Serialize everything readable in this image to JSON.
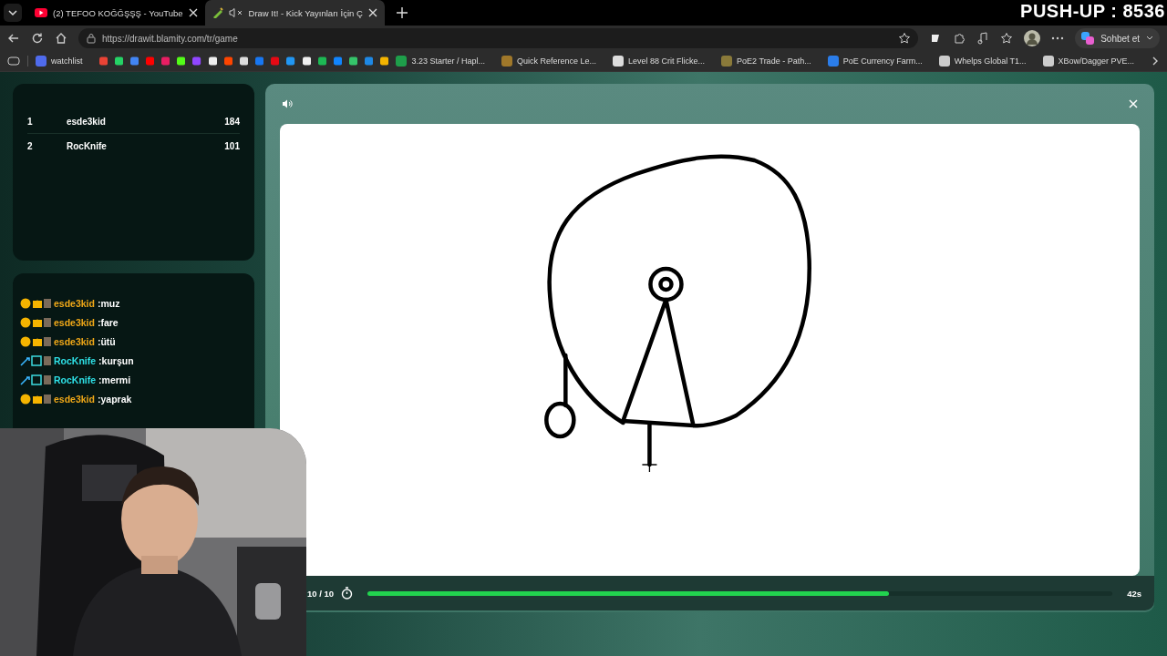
{
  "browser": {
    "tabs": [
      {
        "title": "(2) TEFOO KOĞĞŞŞŞ - YouTube",
        "selected": false,
        "kind": "video"
      },
      {
        "title": "Draw It! - Kick Yayınları İçin Ç",
        "selected": true,
        "kind": "game"
      }
    ],
    "url": "https://drawit.blamity.com/tr/game",
    "chat_button": "Sohbet et",
    "bookmarks": [
      {
        "kind": "labeled",
        "label": "watchlist",
        "color": "#4f6bed"
      },
      {
        "kind": "icon",
        "color": "#ea4335"
      },
      {
        "kind": "icon",
        "color": "#25d366"
      },
      {
        "kind": "icon",
        "color": "#4285f4"
      },
      {
        "kind": "icon",
        "color": "#ff0000"
      },
      {
        "kind": "icon",
        "color": "#e91e63"
      },
      {
        "kind": "icon",
        "color": "#53fc18"
      },
      {
        "kind": "icon",
        "color": "#9146ff"
      },
      {
        "kind": "icon",
        "color": "#eeeeee"
      },
      {
        "kind": "icon",
        "color": "#ff4500"
      },
      {
        "kind": "icon",
        "color": "#dddddd"
      },
      {
        "kind": "icon",
        "color": "#1877f2"
      },
      {
        "kind": "icon",
        "color": "#e50914"
      },
      {
        "kind": "icon",
        "color": "#2196f3"
      },
      {
        "kind": "icon",
        "color": "#f0f0f0"
      },
      {
        "kind": "icon",
        "color": "#1db954"
      },
      {
        "kind": "icon",
        "color": "#1185fe"
      },
      {
        "kind": "icon",
        "color": "#35c46a"
      },
      {
        "kind": "icon",
        "color": "#1e88e5"
      },
      {
        "kind": "icon",
        "color": "#f4b400"
      },
      {
        "kind": "labeled",
        "label": "3.23 Starter / Hapl...",
        "color": "#1e9e4a"
      },
      {
        "kind": "labeled",
        "label": "Quick Reference Le...",
        "color": "#a0782a"
      },
      {
        "kind": "labeled",
        "label": "Level 88 Crit Flicke...",
        "color": "#dddddd"
      },
      {
        "kind": "labeled",
        "label": "PoE2 Trade - Path...",
        "color": "#8a7a3a"
      },
      {
        "kind": "labeled",
        "label": "PoE Currency Farm...",
        "color": "#2b7de9"
      },
      {
        "kind": "labeled",
        "label": "Whelps Global T1...",
        "color": "#cccccc"
      },
      {
        "kind": "labeled",
        "label": "XBow/Dagger PVE...",
        "color": "#cccccc"
      }
    ]
  },
  "overlay": {
    "text": "PUSH-UP : 8536"
  },
  "leaderboard": [
    {
      "rank": "1",
      "name": "esde3kid",
      "score": "184"
    },
    {
      "rank": "2",
      "name": "RocKnife",
      "score": "101"
    }
  ],
  "chat": [
    {
      "user": "esde3kid",
      "message": ":muz",
      "kind": "gold",
      "color": "#f0a818"
    },
    {
      "user": "esde3kid",
      "message": ":fare",
      "kind": "gold",
      "color": "#f0a818"
    },
    {
      "user": "esde3kid",
      "message": ":ütü",
      "kind": "gold",
      "color": "#f0a818"
    },
    {
      "user": "RocKnife",
      "message": ":kurşun",
      "kind": "blue",
      "color": "#2ee0e6"
    },
    {
      "user": "RocKnife",
      "message": ":mermi",
      "kind": "blue",
      "color": "#2ee0e6"
    },
    {
      "user": "esde3kid",
      "message": ":yaprak",
      "kind": "gold",
      "color": "#f0a818"
    }
  ],
  "game": {
    "round": "10 / 10",
    "time": "42s",
    "timer": {
      "level": 0.7
    }
  }
}
